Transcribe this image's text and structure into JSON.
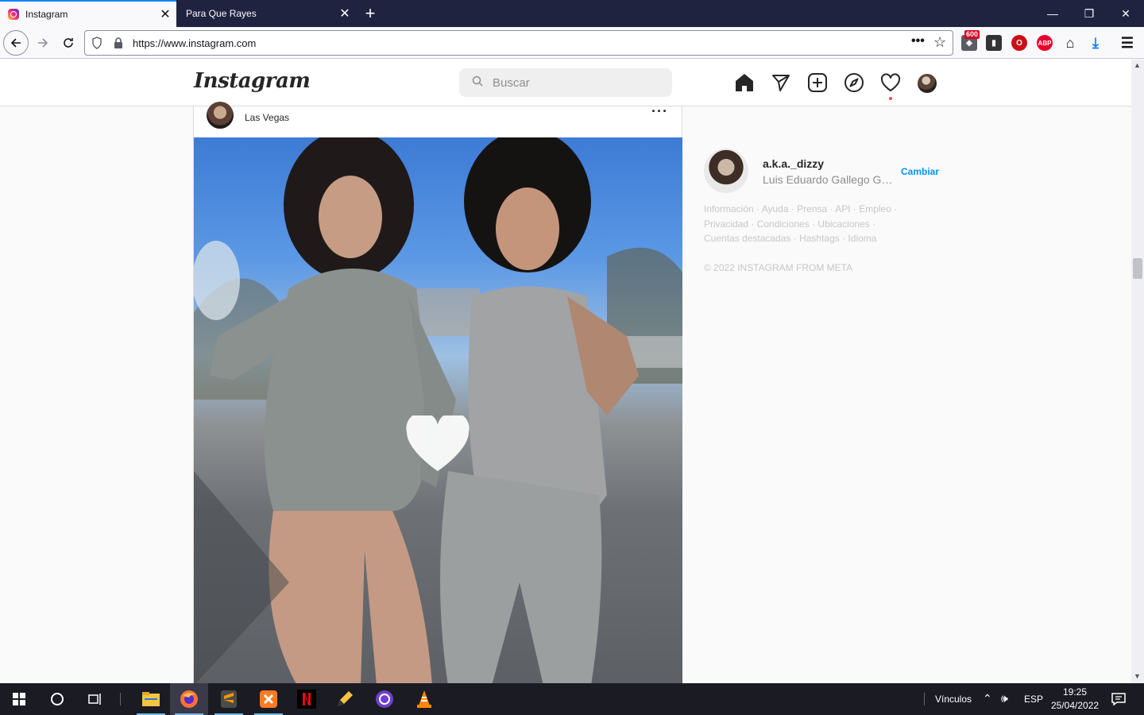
{
  "browser": {
    "tabs": [
      {
        "title": "Instagram",
        "active": true
      },
      {
        "title": "Para Que Rayes",
        "active": false
      }
    ],
    "url": "https://www.instagram.com",
    "extension_badge": "600",
    "window_controls": [
      "minimize-icon",
      "restore-icon",
      "close-icon"
    ]
  },
  "instagram": {
    "logo": "Instagram",
    "search_placeholder": "Buscar",
    "nav_icons": [
      "home-icon",
      "direct-icon",
      "new-post-icon",
      "explore-icon",
      "activity-icon",
      "profile-avatar"
    ],
    "post": {
      "location": "Las Vegas"
    },
    "sidebar": {
      "username": "a.k.a._dizzy",
      "full_name": "Luis Eduardo Gallego Gar...",
      "switch_label": "Cambiar",
      "footer_line1": "Información · Ayuda · Prensa · API · Empleo ·",
      "footer_line2": "Privacidad · Condiciones · Ubicaciones ·",
      "footer_line3": "Cuentas destacadas · Hashtags · Idioma",
      "copyright": "© 2022 INSTAGRAM FROM META"
    }
  },
  "taskbar": {
    "links_label": "Vínculos",
    "language": "ESP",
    "time": "19:25",
    "date": "25/04/2022",
    "pinned_apps": [
      "file-explorer",
      "firefox",
      "sublime-text",
      "xampp",
      "netflix",
      "pencil-app",
      "github-desktop",
      "vlc"
    ]
  },
  "colors": {
    "tab_bar": "#202340",
    "accent_blue": "#0095f6",
    "notification_red": "#ed4956",
    "taskbar": "#1b1b24"
  }
}
